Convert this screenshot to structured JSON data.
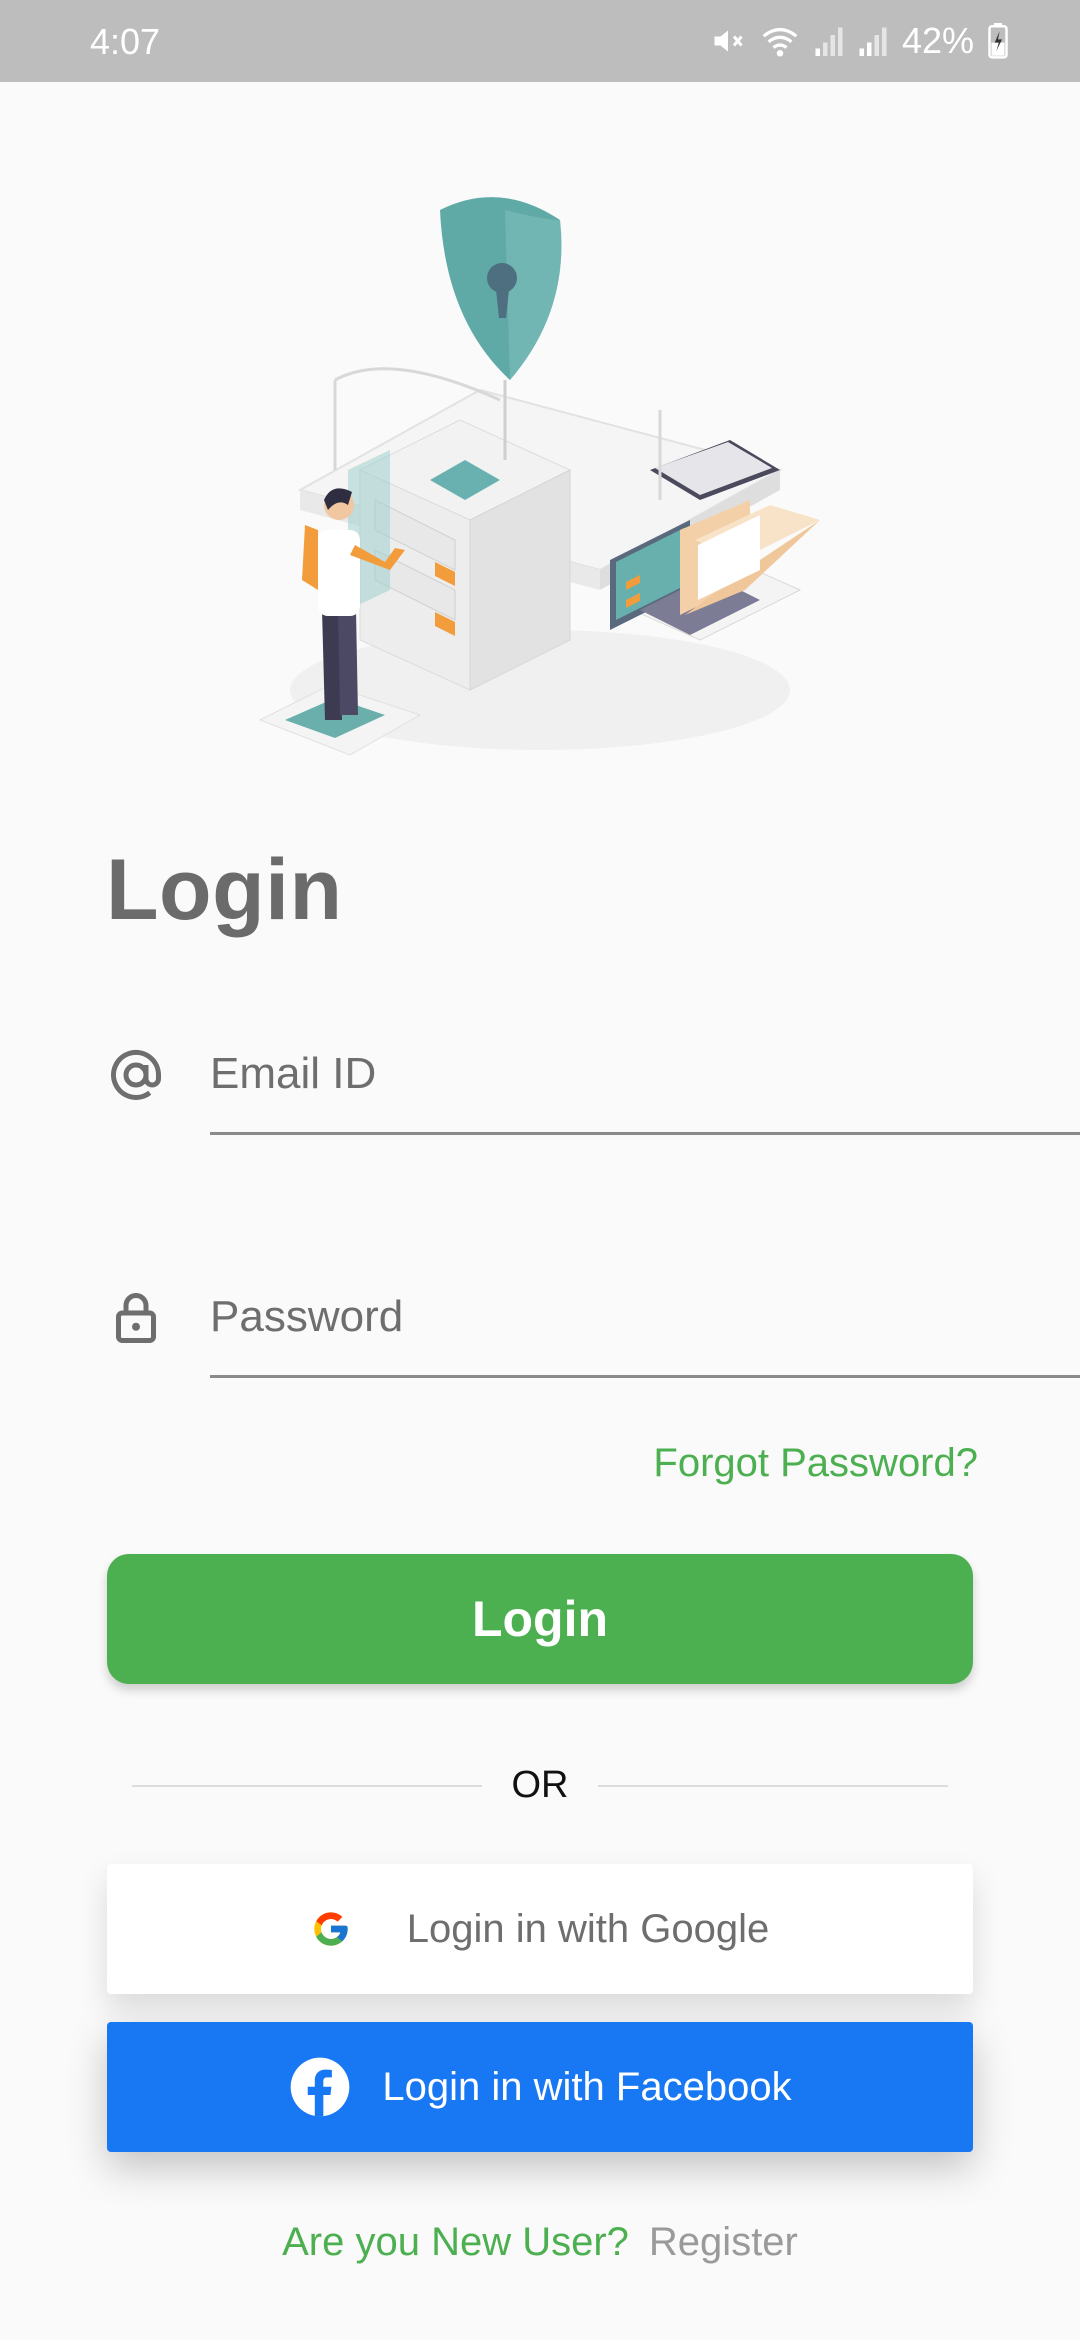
{
  "status_bar": {
    "time": "4:07",
    "battery": "42%",
    "icons": [
      "mute-icon",
      "wifi-icon",
      "signal-icon",
      "signal-icon",
      "battery-icon"
    ]
  },
  "illustration": "security-login-illustration",
  "title": "Login",
  "form": {
    "email_placeholder": "Email ID",
    "email_icon": "at-icon",
    "password_placeholder": "Password",
    "password_icon": "lock-icon",
    "forgot_label": "Forgot Password?",
    "login_label": "Login"
  },
  "divider": {
    "label": "OR"
  },
  "social": {
    "google_label": "Login in with Google",
    "google_icon": "google-icon",
    "facebook_label": "Login in with Facebook",
    "facebook_icon": "facebook-icon"
  },
  "register": {
    "prompt": "Are you New User?",
    "link": "Register"
  },
  "colors": {
    "accent_green": "#4caf50",
    "facebook_blue": "#1877f2",
    "status_bar": "#bdbdbd",
    "title_gray": "#6b6b6b"
  }
}
